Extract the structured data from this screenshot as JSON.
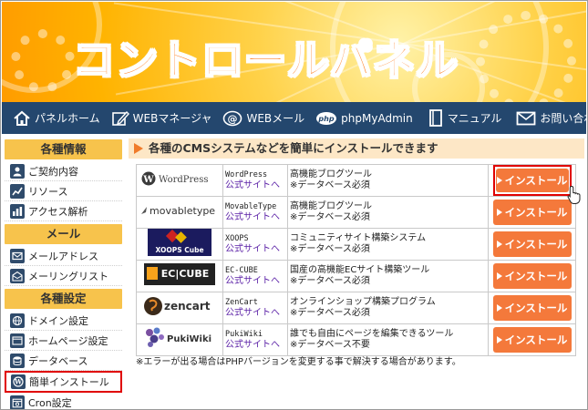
{
  "banner": {
    "title": "コントロールパネル"
  },
  "nav": {
    "items": [
      {
        "label": "パネルホーム",
        "icon": "home-icon"
      },
      {
        "label": "WEBマネージャ",
        "icon": "edit-icon"
      },
      {
        "label": "WEBメール",
        "icon": "mail-at-icon"
      },
      {
        "label": "phpMyAdmin",
        "icon": "php-icon",
        "badge": "php"
      },
      {
        "label": "マニュアル",
        "icon": "book-icon"
      },
      {
        "label": "お問い合わせ",
        "icon": "envelope-icon"
      }
    ]
  },
  "sidebar": {
    "sections": [
      {
        "title": "各種情報",
        "items": [
          "ご契約内容",
          "リソース",
          "アクセス解析"
        ]
      },
      {
        "title": "メール",
        "items": [
          "メールアドレス",
          "メーリングリスト"
        ]
      },
      {
        "title": "各種設定",
        "items": [
          "ドメイン設定",
          "ホームページ設定",
          "データベース",
          "簡単インストール",
          "Cron設定"
        ]
      }
    ],
    "highlighted": "簡単インストール"
  },
  "main": {
    "heading": "各種のCMSシステムなどを簡単にインストールできます",
    "link_label": "公式サイトへ",
    "install_label": "インストール",
    "rows": [
      {
        "logo": "WordPress",
        "name": "WordPress",
        "desc1": "高機能ブログツール",
        "desc2": "※データベース必須"
      },
      {
        "logo": "movabletype",
        "name": "MovableType",
        "desc1": "高機能ブログツール",
        "desc2": "※データベース必須"
      },
      {
        "logo": "XOOPS Cube",
        "name": "XOOPS",
        "desc1": "コミュニティサイト構築システム",
        "desc2": "※データベース必須"
      },
      {
        "logo": "EC|CUBE",
        "name": "EC-CUBE",
        "desc1": "国産の高機能ECサイト構築ツール",
        "desc2": "※データベース必須"
      },
      {
        "logo": "zencart",
        "name": "ZenCart",
        "desc1": "オンラインショップ構築プログラム",
        "desc2": "※データベース必須"
      },
      {
        "logo": "PukiWiki",
        "name": "PukiWiki",
        "desc1": "誰でも自由にページを編集できるツール",
        "desc2": "※データベース不要"
      }
    ],
    "note": "※エラーが出る場合はPHPバージョンを変更する事で解決する場合があります。"
  },
  "colors": {
    "accent": "#f4793b",
    "nav_bg": "#24476e",
    "sidebar_head": "#f7c34c",
    "highlight": "#e00000"
  }
}
